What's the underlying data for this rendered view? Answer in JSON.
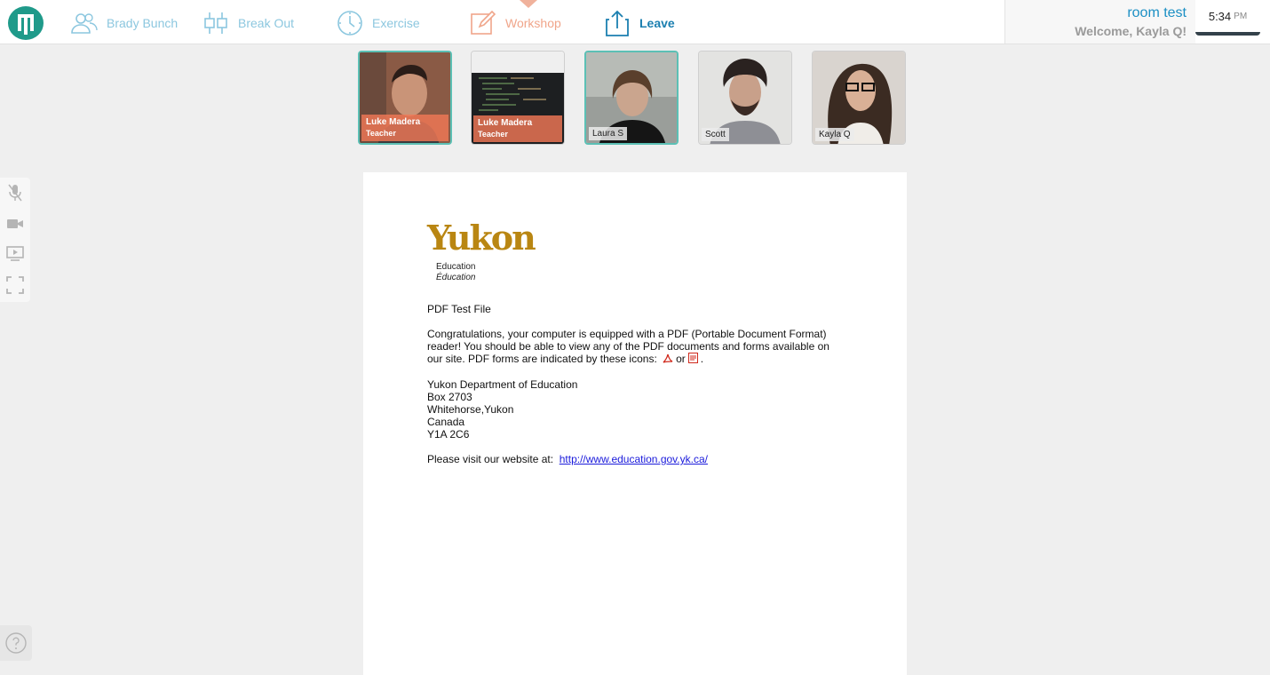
{
  "nav": {
    "items": [
      {
        "label": "Brady Bunch",
        "icon": "people-icon"
      },
      {
        "label": "Break Out",
        "icon": "breakout-icon"
      },
      {
        "label": "Exercise",
        "icon": "clock-icon"
      },
      {
        "label": "Workshop",
        "icon": "pencil-icon",
        "active": true
      },
      {
        "label": "Leave",
        "icon": "share-icon"
      }
    ]
  },
  "room": {
    "name": "room test",
    "welcome": "Welcome, Kayla Q!"
  },
  "clock": {
    "time": "5:34",
    "ampm": "PM"
  },
  "participants": [
    {
      "name": "Luke Madera",
      "role": "Teacher",
      "variant": "camera"
    },
    {
      "name": "Luke Madera",
      "role": "Teacher",
      "variant": "screen"
    },
    {
      "name": "Laura S"
    },
    {
      "name": "Scott"
    },
    {
      "name": "Kayla Q"
    }
  ],
  "document": {
    "logo_word": "Yukon",
    "logo_line1": "Education",
    "logo_line2": "Éducation",
    "title": "PDF Test File",
    "para1_a": "Congratulations, your computer is equipped with a PDF (Portable Document Format) reader!  You should be able to view any of the PDF documents and forms available on our site.  PDF forms are indicated by these icons:",
    "para1_or": "or",
    "address": [
      "Yukon Department of Education",
      "Box 2703",
      "Whitehorse,Yukon",
      "Canada",
      "Y1A 2C6"
    ],
    "visit_label": "Please visit our website at:",
    "website": "http://www.education.gov.yk.ca/"
  },
  "colors": {
    "brand": "#1f9a8a",
    "nav": "#8cc7df",
    "active": "#f0a58a",
    "leave": "#1b7fb0",
    "yukon": "#b98612"
  }
}
